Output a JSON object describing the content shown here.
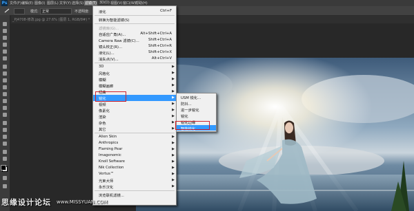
{
  "app": {
    "logo": "Ps"
  },
  "menubar": {
    "items": [
      "文件(F)",
      "编辑(E)",
      "图像(I)",
      "图层(L)",
      "文字(Y)",
      "选择(S)",
      "滤镜(T)",
      "3D(D)",
      "视图(V)",
      "窗口(W)",
      "帮助(H)"
    ],
    "active_index": 6
  },
  "options_bar": {
    "mode_label": "模式:",
    "mode_value": "正常",
    "opacity_label": "不透明度:"
  },
  "document_tab": {
    "title": "_PJ4708-修改.jpg @ 27.6% (图层 1, RGB/8#) *"
  },
  "filter_menu": {
    "items": [
      {
        "label": "液化",
        "shortcut": "Ctrl+F"
      },
      {
        "sep": true
      },
      {
        "label": "转换为智能滤镜(S)"
      },
      {
        "sep": true
      },
      {
        "label": "滤镜库(G)...",
        "disabled": true
      },
      {
        "label": "自适应广角(A)...",
        "shortcut": "Alt+Shift+Ctrl+A"
      },
      {
        "label": "Camera Raw 滤镜(C)...",
        "shortcut": "Shift+Ctrl+A"
      },
      {
        "label": "镜头校正(R)...",
        "shortcut": "Shift+Ctrl+R"
      },
      {
        "label": "液化(L)...",
        "shortcut": "Shift+Ctrl+X"
      },
      {
        "label": "消失点(V)...",
        "shortcut": "Alt+Ctrl+V"
      },
      {
        "sep": true
      },
      {
        "label": "3D",
        "submenu": true
      },
      {
        "label": "风格化",
        "submenu": true
      },
      {
        "label": "模糊",
        "submenu": true
      },
      {
        "label": "模糊画廊",
        "submenu": true
      },
      {
        "label": "扭曲",
        "submenu": true
      },
      {
        "label": "锐化",
        "submenu": true,
        "highlighted": true
      },
      {
        "label": "视频",
        "submenu": true
      },
      {
        "label": "像素化",
        "submenu": true
      },
      {
        "label": "渲染",
        "submenu": true
      },
      {
        "label": "杂色",
        "submenu": true
      },
      {
        "label": "其它",
        "submenu": true
      },
      {
        "sep": true
      },
      {
        "label": "Alien Skin",
        "submenu": true
      },
      {
        "label": "Anthropics",
        "submenu": true
      },
      {
        "label": "Flaming Pear",
        "submenu": true
      },
      {
        "label": "Imagenomic",
        "submenu": true
      },
      {
        "label": "Knoll Software",
        "submenu": true
      },
      {
        "label": "Nik Collection",
        "submenu": true
      },
      {
        "label": "Vertus™",
        "submenu": true
      },
      {
        "label": "光束大师",
        "submenu": true
      },
      {
        "label": "永乐汉化",
        "submenu": true
      },
      {
        "sep": true
      },
      {
        "label": "浏览联机滤镜..."
      }
    ]
  },
  "sharpen_submenu": {
    "items": [
      {
        "label": "USM 锐化..."
      },
      {
        "label": "防抖..."
      },
      {
        "label": "进一步锐化"
      },
      {
        "label": "锐化"
      },
      {
        "label": "锐化边缘"
      },
      {
        "label": "智能锐化...",
        "highlighted": true
      }
    ]
  },
  "watermark": {
    "text": "思缘设计论坛",
    "url": "www.MISSYUAN.COM"
  },
  "colors": {
    "menu_highlight": "#3399ff",
    "annotation_red": "#d0202a"
  }
}
